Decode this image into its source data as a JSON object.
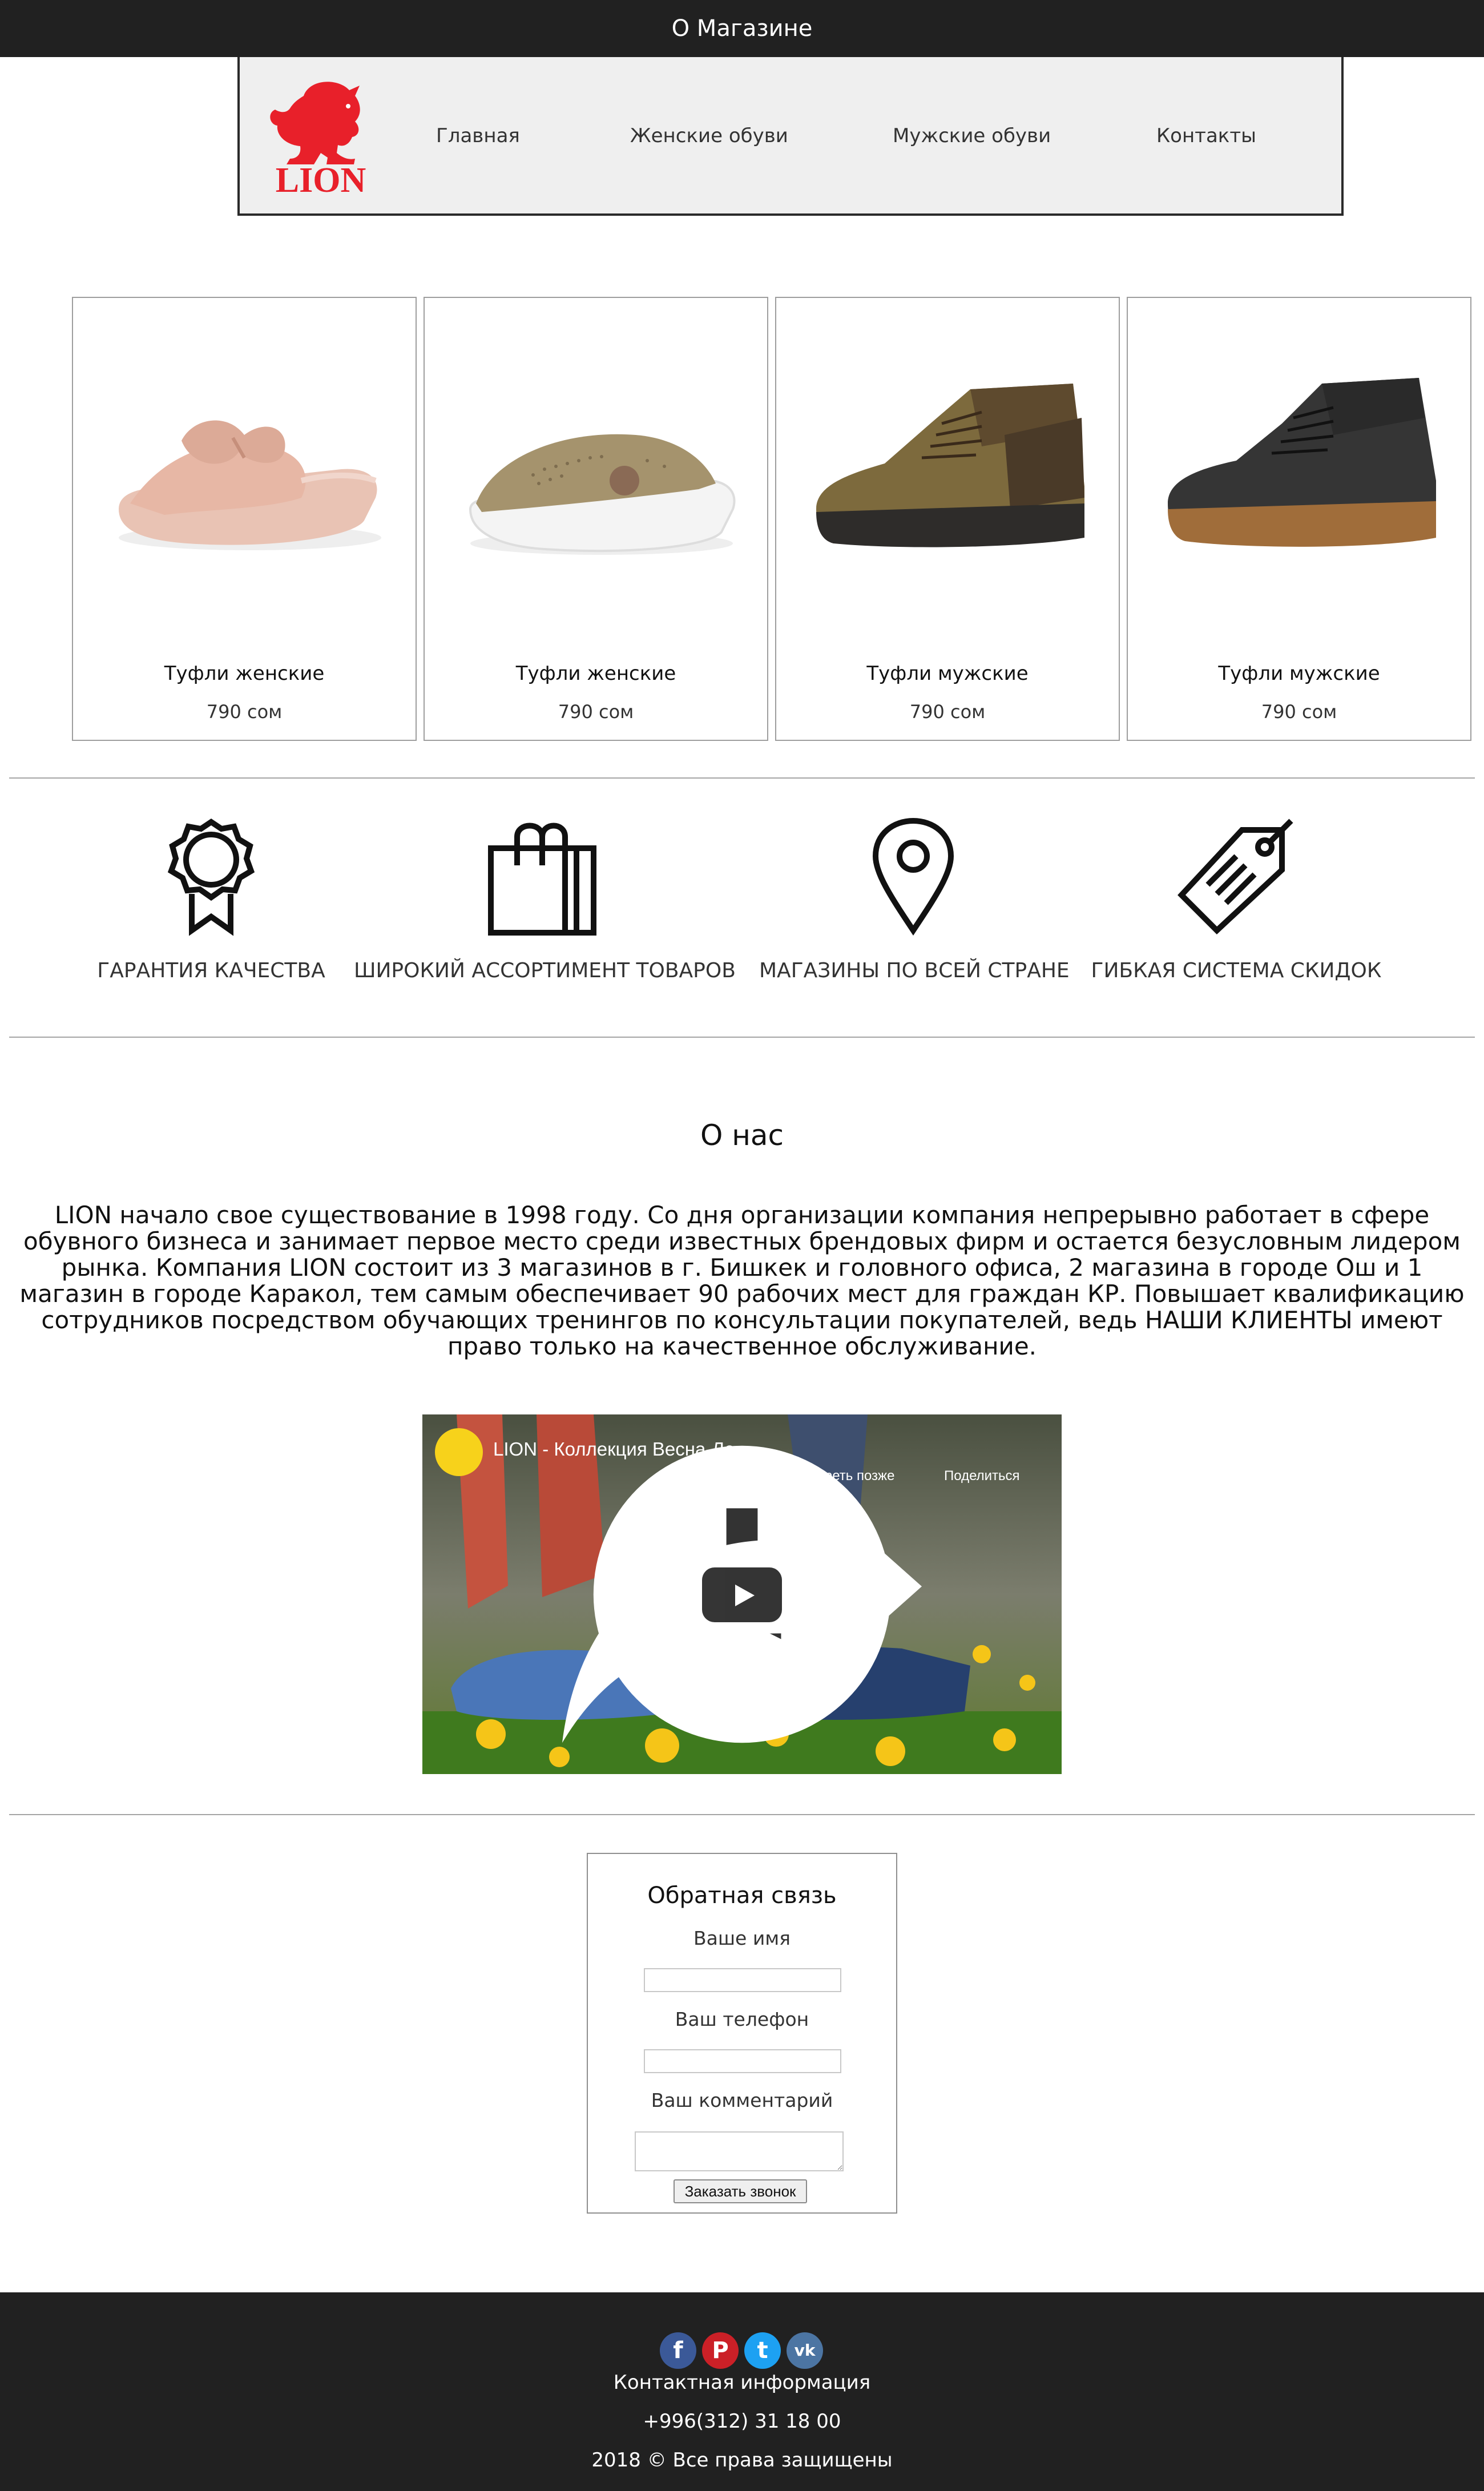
{
  "header": {
    "title": "О Магазине"
  },
  "logo": {
    "text": "LION"
  },
  "nav": {
    "items": [
      "Главная",
      "Женские обуви",
      "Мужские обуви",
      "Контакты"
    ]
  },
  "products": [
    {
      "title": "Туфли женские",
      "price": "790 сом"
    },
    {
      "title": "Туфли женские",
      "price": "790 сом"
    },
    {
      "title": "Туфли мужские",
      "price": "790 сом"
    },
    {
      "title": "Туфли мужские",
      "price": "790 сом"
    }
  ],
  "features": [
    {
      "icon": "award-icon",
      "label": "ГАРАНТИЯ КАЧЕСТВА"
    },
    {
      "icon": "shopping-bag-icon",
      "label": "ШИРОКИЙ АССОРТИМЕНТ ТОВАРОВ"
    },
    {
      "icon": "map-pin-icon",
      "label": "МАГАЗИНЫ ПО ВСЕЙ СТРАНЕ"
    },
    {
      "icon": "price-tag-icon",
      "label": "ГИБКАЯ СИСТЕМА СКИДОК"
    }
  ],
  "about": {
    "heading": "О нас",
    "text": "LION начало свое существование в 1998 году. Со дня организации компания непрерывно работает в сфере обувного бизнеса и занимает первое место среди известных брендовых фирм и остается безусловным лидером рынка. Компания LION состоит из 3 магазинов в г. Бишкек и головного офиса, 2 магазина в городе Ош и 1 магазин в городе Каракол, тем самым обеспечивает 90 рабочих мест для граждан КР. Повышает квалификацию сотрудников посредством обучающих тренингов по консультации покупателей, ведь НАШИ КЛИЕНТЫ имеют право только на качественное обслуживание."
  },
  "video": {
    "title": "LION - Коллекция Весна-Ле...",
    "watch_later": "Посмотреть позже",
    "share": "Поделиться"
  },
  "feedback": {
    "title": "Обратная связь",
    "name_label": "Ваше имя",
    "name_value": "",
    "phone_label": "Ваш телефон",
    "phone_value": "",
    "comment_label": "Ваш комментарий",
    "comment_value": "",
    "button": "Заказать звонок"
  },
  "footer": {
    "social": [
      {
        "icon": "facebook-icon",
        "color": "#3b5998",
        "glyph": "f"
      },
      {
        "icon": "pinterest-icon",
        "color": "#cb2027",
        "glyph": "P"
      },
      {
        "icon": "twitter-icon",
        "color": "#1da1f2",
        "glyph": "t"
      },
      {
        "icon": "vk-icon",
        "color": "#4c75a3",
        "glyph": "vk"
      }
    ],
    "contact_heading": "Контактная информация",
    "phone": "+996(312) 31 18 00",
    "copyright": "2018 © Все права защищены"
  },
  "colors": {
    "dark": "#212121",
    "nav_bg": "#efefef",
    "brand_red": "#e8202a"
  }
}
